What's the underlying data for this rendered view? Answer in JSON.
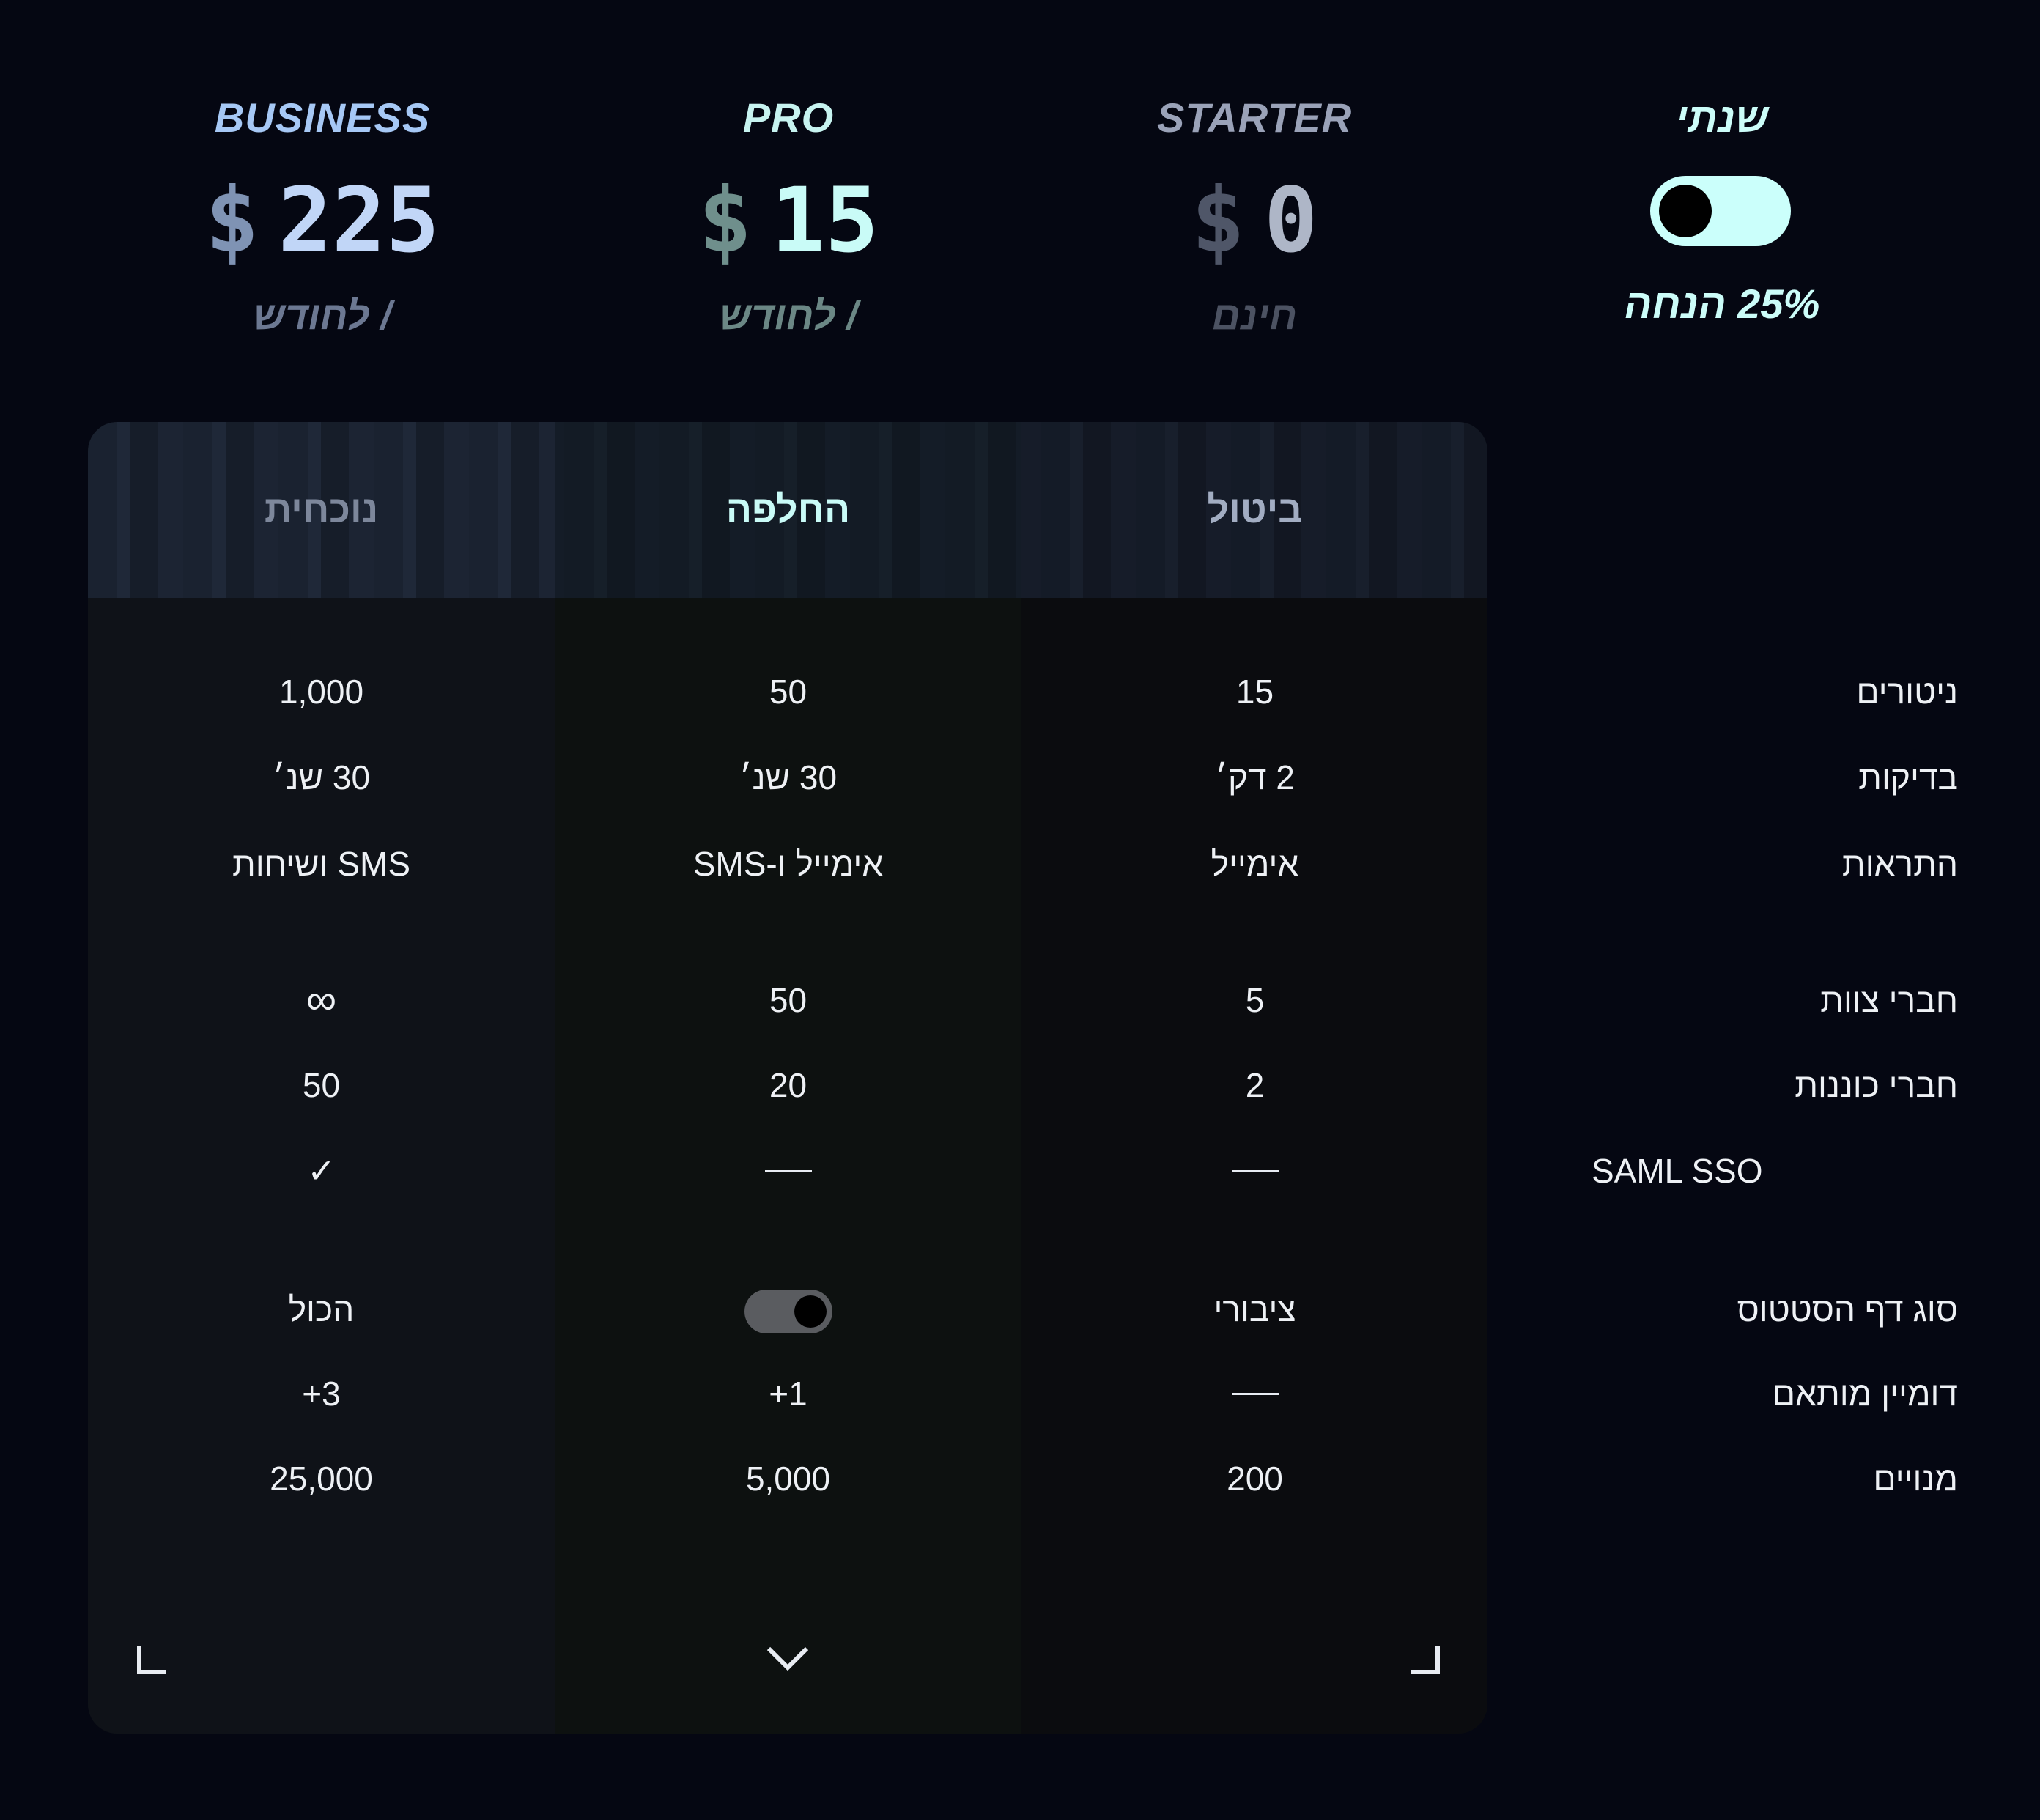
{
  "plans": {
    "business": {
      "name": "BUSINESS",
      "currency": "$",
      "amount": "225",
      "period": "/ לחודש"
    },
    "pro": {
      "name": "PRO",
      "currency": "$",
      "amount": "15",
      "period": "/ לחודש"
    },
    "starter": {
      "name": "STARTER",
      "currency": "$",
      "amount": "0",
      "period": "חינם"
    }
  },
  "billing": {
    "annual_label": "שנתי",
    "annual_on": true,
    "discount": "25% הנחה"
  },
  "actions": {
    "current": "נוכחית",
    "switch": "החלפה",
    "cancel": "ביטול"
  },
  "features": [
    {
      "label": "ניטורים",
      "business": "1,000",
      "pro": "50",
      "starter": "15"
    },
    {
      "label": "בדיקות",
      "business": "30 שנ׳",
      "pro": "30 שנ׳",
      "starter": "2 דק׳"
    },
    {
      "label": "התראות",
      "business": "SMS ושיחות",
      "pro": "אימייל ו-SMS",
      "starter": "אימייל"
    },
    {
      "label": "חברי צוות",
      "business": "∞",
      "pro": "50",
      "starter": "5"
    },
    {
      "label": "חברי כוננות",
      "business": "50",
      "pro": "20",
      "starter": "2"
    },
    {
      "label": "SAML SSO",
      "business": "✓",
      "pro": "—",
      "starter": "—"
    },
    {
      "label": "סוג דף הסטטוס",
      "business": "הכול",
      "pro": "toggle",
      "starter": "ציבורי"
    },
    {
      "label": "דומיין מותאם",
      "business": "+3",
      "pro": "+1",
      "starter": "—"
    },
    {
      "label": "מנויים",
      "business": "25,000",
      "pro": "5,000",
      "starter": "200"
    }
  ],
  "pro_status_page_toggle_on": true,
  "icons": {
    "footer_left": "corner-bottom-left-icon",
    "footer_center": "chevron-down-icon",
    "footer_right": "corner-bottom-right-icon"
  },
  "colors": {
    "background": "#050712",
    "accent": "#cbfffb",
    "pro_accent": "#c9fbf7",
    "business_accent": "#a6c8f5"
  }
}
